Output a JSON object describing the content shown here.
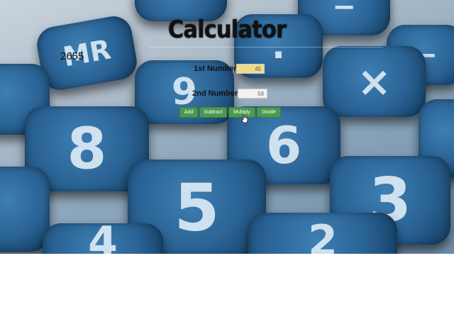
{
  "app": {
    "title": "Calculator"
  },
  "result": {
    "value": "2655"
  },
  "form": {
    "first_label": "1st Number:",
    "first_value": "45",
    "second_label": "2nd Number:",
    "second_value": "59"
  },
  "buttons": {
    "add": "Add",
    "subtract": "Subtract",
    "multiply": "Multiply",
    "divide": "Divide"
  },
  "background_keys": {
    "mr": "MR",
    "minus_top": "−",
    "dot": ".",
    "multiply": "×",
    "minus_right": "−",
    "nine": "9",
    "eight": "8",
    "six": "6",
    "five": "5",
    "three": "3",
    "four": "4",
    "two": "2"
  },
  "colors": {
    "button_green": "#4c9a4f",
    "first_input_bg": "#eedb8a",
    "key_blue": "#2a6294"
  }
}
